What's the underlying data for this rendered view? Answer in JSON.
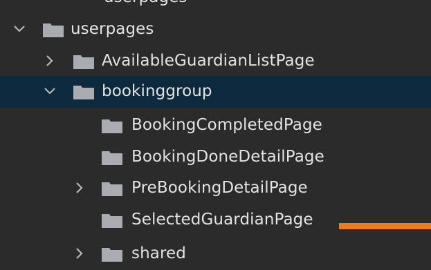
{
  "accent_color": "#ec7b2c",
  "selected_row_color": "#0d293e",
  "tree": {
    "partial_top_label": "userpages",
    "items": [
      {
        "label": "userpages",
        "icon": "folder-icon",
        "chevron": "chevron-down-icon"
      },
      {
        "label": "AvailableGuardianListPage",
        "icon": "folder-icon",
        "chevron": "chevron-right-icon"
      },
      {
        "label": "bookinggroup",
        "icon": "folder-icon",
        "chevron": "chevron-down-icon",
        "selected": true
      },
      {
        "label": "BookingCompletedPage",
        "icon": "folder-icon"
      },
      {
        "label": "BookingDoneDetailPage",
        "icon": "folder-icon"
      },
      {
        "label": "PreBookingDetailPage",
        "icon": "folder-icon",
        "chevron": "chevron-right-icon"
      },
      {
        "label": "SelectedGuardianPage",
        "icon": "folder-icon"
      },
      {
        "label": "shared",
        "icon": "folder-icon",
        "chevron": "chevron-right-icon"
      }
    ]
  }
}
